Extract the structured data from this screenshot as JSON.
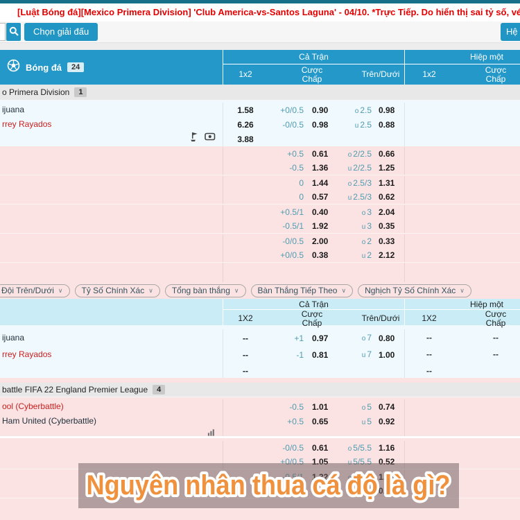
{
  "colors": {
    "accent_blue": "#2498c8",
    "header2_bg": "#c9ecf6",
    "pink_row": "#fbe3e3",
    "light_row": "#f0f9fd",
    "odds_teal": "#4f9cb0",
    "banner_orange": "#ef913d",
    "marquee_red": "#e30000"
  },
  "icons": {
    "search": "search-icon",
    "soccer": "soccer-ball-icon",
    "corner_flag": "corner-flag-icon",
    "live": "live-video-icon",
    "stats": "stats-chart-icon",
    "chevron": "chevron-down-icon"
  },
  "marquee": {
    "text": "[Luật Bóng đá][Mexico Primera Division] 'Club America-vs-Santos Laguna' - 04/10. *Trực Tiếp. Do hiển thị sai tỷ số, vé cược bị ảnh hưởng sẽ được HC"
  },
  "toolbar": {
    "league_button": "Chọn giải đấu",
    "help_button": "Hệ"
  },
  "sport": {
    "label": "Bóng đá",
    "count": "24"
  },
  "table1_header": {
    "full": "Cả Trận",
    "half": "Hiệp một",
    "x12": "1x2",
    "handicap": "Cược Chấp",
    "ou": "Trên/Dưới",
    "h_x12": "1x2",
    "h_handicap": "Cược Chấp"
  },
  "table2_header": {
    "full": "Cả Trận",
    "half": "Hiệp một",
    "x12": "1X2",
    "handicap": "Cược Chấp",
    "ou": "Trên/Dưới",
    "h_x12": "1X2",
    "h_handicap": "Cược Chấp"
  },
  "league1": {
    "name": "o Primera Division",
    "count": "1"
  },
  "league2": {
    "name": "battle FIFA 22 England Premier League",
    "count": "4"
  },
  "filters": {
    "0": "Đội Trên/Dưới",
    "1": "Tỷ Số Chính Xác",
    "2": "Tổng bàn thắng",
    "3": "Bàn Thắng Tiếp Theo",
    "4": "Nghịch Tỷ Số Chính Xác"
  },
  "match1": {
    "rows": [
      {
        "team": "ijuana",
        "x12": "1.58",
        "hcp": "+0/0.5",
        "hcpOdds": "0.90",
        "ouSide": "o",
        "ou": "2.5",
        "ouOdds": "0.98"
      },
      {
        "team": "rrey Rayados",
        "x12": "6.26",
        "hcp": "-0/0.5",
        "hcpOdds": "0.98",
        "ouSide": "u",
        "ou": "2.5",
        "ouOdds": "0.88"
      },
      {
        "x12": "3.88"
      }
    ]
  },
  "extra1": [
    {
      "hcp": "+0.5",
      "hcpOdds": "0.61",
      "ouSide": "o",
      "ou": "2/2.5",
      "ouOdds": "0.66"
    },
    {
      "hcp": "-0.5",
      "hcpOdds": "1.36",
      "ouSide": "u",
      "ou": "2/2.5",
      "ouOdds": "1.25"
    },
    {
      "hcp": "0",
      "hcpOdds": "1.44",
      "ouSide": "o",
      "ou": "2.5/3",
      "ouOdds": "1.31"
    },
    {
      "hcp": "0",
      "hcpOdds": "0.57",
      "ouSide": "u",
      "ou": "2.5/3",
      "ouOdds": "0.62"
    },
    {
      "hcp": "+0.5/1",
      "hcpOdds": "0.40",
      "ouSide": "o",
      "ou": "3",
      "ouOdds": "2.04"
    },
    {
      "hcp": "-0.5/1",
      "hcpOdds": "1.92",
      "ouSide": "u",
      "ou": "3",
      "ouOdds": "0.35"
    },
    {
      "hcp": "-0/0.5",
      "hcpOdds": "2.00",
      "ouSide": "o",
      "ou": "2",
      "ouOdds": "0.33"
    },
    {
      "hcp": "+0/0.5",
      "hcpOdds": "0.38",
      "ouSide": "u",
      "ou": "2",
      "ouOdds": "2.12"
    }
  ],
  "match2": {
    "rows": [
      {
        "team": "ijuana",
        "x12": "--",
        "hcp": "+1",
        "hcpOdds": "0.97",
        "ouSide": "o",
        "ou": "7",
        "ouOdds": "0.80",
        "h1x12": "--",
        "h1hcp": "--"
      },
      {
        "team": "rrey Rayados",
        "x12": "--",
        "hcp": "-1",
        "hcpOdds": "0.81",
        "ouSide": "u",
        "ou": "7",
        "ouOdds": "1.00",
        "h1x12": "--",
        "h1hcp": "--"
      },
      {
        "x12": "--",
        "h1x12": "--"
      }
    ]
  },
  "match3": {
    "rows": [
      {
        "team": "ool (Cyberbattle)",
        "hcp": "-0.5",
        "hcpOdds": "1.01",
        "ouSide": "o",
        "ou": "5",
        "ouOdds": "0.74"
      },
      {
        "team": "Ham United (Cyberbattle)",
        "hcp": "+0.5",
        "hcpOdds": "0.65",
        "ouSide": "u",
        "ou": "5",
        "ouOdds": "0.92"
      }
    ]
  },
  "extra3": [
    {
      "hcp": "-0/0.5",
      "hcpOdds": "0.61",
      "ouSide": "o",
      "ou": "5/5.5",
      "ouOdds": "1.16"
    },
    {
      "hcp": "+0/0.5",
      "hcpOdds": "1.05",
      "ouSide": "u",
      "ou": "5/5.5",
      "ouOdds": "0.52"
    },
    {
      "hcp": "-0.5/1",
      "hcpOdds": "1.32",
      "ouSide": "o",
      "ou": "4.5/5",
      "ouOdds": "1.42"
    },
    {
      "hcp": "+0.5/1",
      "hcpOdds": "0.42",
      "ouSide": "u",
      "ou": "4.5/5",
      "ouOdds": "0.51"
    }
  ],
  "overlay": {
    "text": "Nguyên nhân thua cá độ là gì?"
  }
}
